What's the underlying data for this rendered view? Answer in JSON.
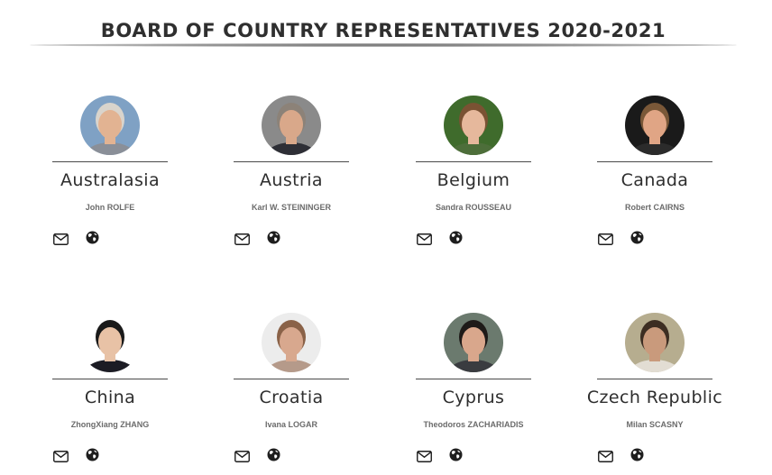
{
  "page": {
    "title": "BOARD OF COUNTRY REPRESENTATIVES 2020-2021"
  },
  "representatives": [
    {
      "country": "Australasia",
      "name": "John ROLFE",
      "photo": {
        "bg": "#7fa1c4",
        "skin": "#e2b392",
        "hair": "#d9d4cc",
        "shirt": "#8a8f98"
      }
    },
    {
      "country": "Austria",
      "name": "Karl W. STEININGER",
      "photo": {
        "bg": "#8a8a8a",
        "skin": "#d9a88a",
        "hair": "#8c8278",
        "shirt": "#2e2f36"
      }
    },
    {
      "country": "Belgium",
      "name": "Sandra ROUSSEAU",
      "photo": {
        "bg": "#3f6b2c",
        "skin": "#e6b89c",
        "hair": "#7a5233",
        "shirt": "#4d6e3a"
      }
    },
    {
      "country": "Canada",
      "name": "Robert CAIRNS",
      "photo": {
        "bg": "#1a1a1a",
        "skin": "#e0a585",
        "hair": "#7a5838",
        "shirt": "#2b2b2b"
      }
    },
    {
      "country": "China",
      "name": "ZhongXiang ZHANG",
      "photo": {
        "bg": "#ffffff",
        "skin": "#e8c2a6",
        "hair": "#1a1a1a",
        "shirt": "#1c1c24"
      }
    },
    {
      "country": "Croatia",
      "name": "Ivana LOGAR",
      "photo": {
        "bg": "#ececec",
        "skin": "#d8a88e",
        "hair": "#8a6248",
        "shirt": "#b59a8a"
      }
    },
    {
      "country": "Cyprus",
      "name": "Theodoros ZACHARIADIS",
      "photo": {
        "bg": "#6b7a6e",
        "skin": "#d9a78c",
        "hair": "#1e1a18",
        "shirt": "#3a3c40"
      }
    },
    {
      "country": "Czech Republic",
      "name": "Milan SCASNY",
      "photo": {
        "bg": "#b6ad8f",
        "skin": "#c99a7c",
        "hair": "#3c2d22",
        "shirt": "#e2ddd3"
      }
    }
  ],
  "icons": {
    "email": "envelope-icon",
    "website": "globe-icon"
  }
}
